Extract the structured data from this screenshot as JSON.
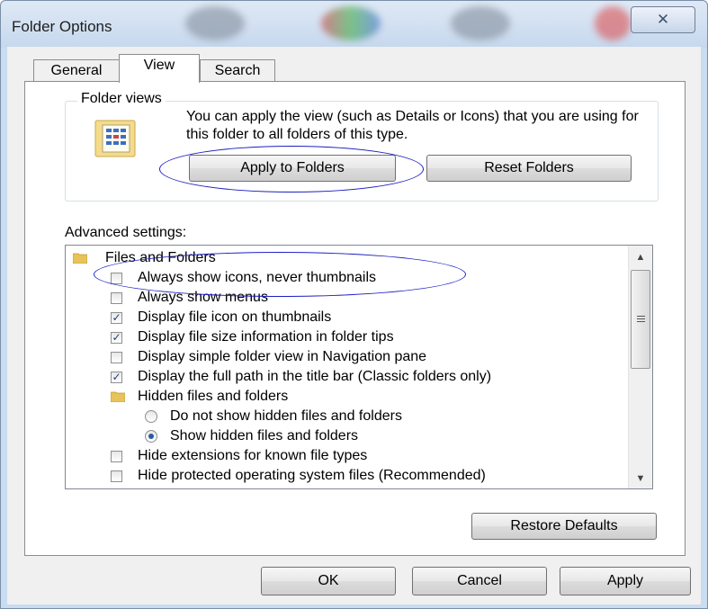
{
  "window": {
    "title": "Folder Options",
    "close_symbol": "✕"
  },
  "tabs": [
    {
      "label": "General"
    },
    {
      "label": "View"
    },
    {
      "label": "Search"
    }
  ],
  "folder_views": {
    "group_label": "Folder views",
    "description": "You can apply the view (such as Details or Icons) that you are using for this folder to all folders of this type.",
    "apply_button": "Apply to Folders",
    "reset_button": "Reset Folders"
  },
  "advanced": {
    "label": "Advanced settings:",
    "items": [
      {
        "type": "folder",
        "label": "Files and Folders"
      },
      {
        "type": "checkbox",
        "label": "Always show icons, never thumbnails",
        "checked": false
      },
      {
        "type": "checkbox",
        "label": "Always show menus",
        "checked": false
      },
      {
        "type": "checkbox",
        "label": "Display file icon on thumbnails",
        "checked": true
      },
      {
        "type": "checkbox",
        "label": "Display file size information in folder tips",
        "checked": true
      },
      {
        "type": "checkbox",
        "label": "Display simple folder view in Navigation pane",
        "checked": false
      },
      {
        "type": "checkbox",
        "label": "Display the full path in the title bar (Classic folders only)",
        "checked": true
      },
      {
        "type": "folder",
        "label": "Hidden files and folders"
      },
      {
        "type": "radio",
        "label": "Do not show hidden files and folders",
        "selected": false
      },
      {
        "type": "radio",
        "label": "Show hidden files and folders",
        "selected": true
      },
      {
        "type": "checkbox",
        "label": "Hide extensions for known file types",
        "checked": false
      },
      {
        "type": "checkbox",
        "label": "Hide protected operating system files (Recommended)",
        "checked": false
      }
    ],
    "restore_button": "Restore Defaults"
  },
  "footer": {
    "ok": "OK",
    "cancel": "Cancel",
    "apply": "Apply"
  },
  "colors": {
    "annotation": "#1b1fc0",
    "check": "#1c3f78",
    "folder": "#e8c25a"
  }
}
